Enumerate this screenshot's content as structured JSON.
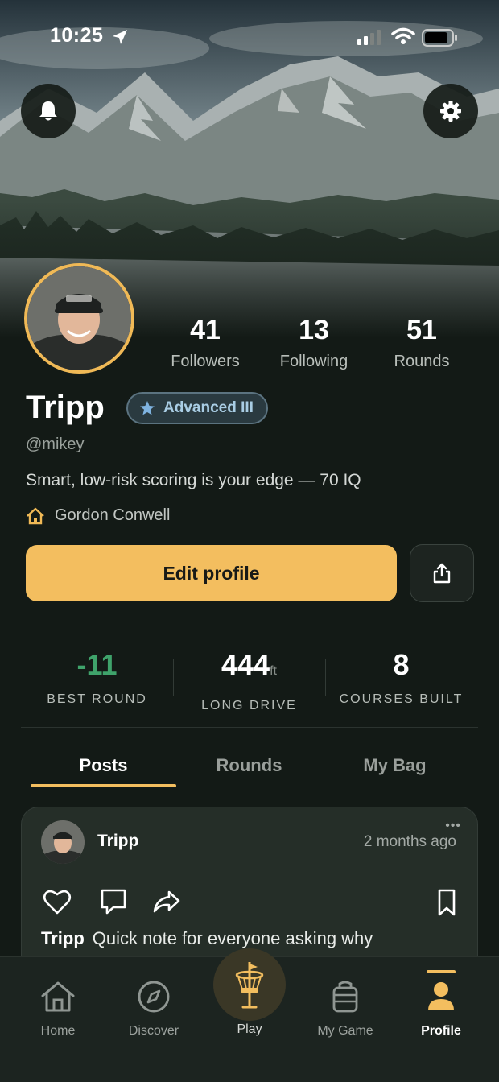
{
  "status_bar": {
    "time": "10:25"
  },
  "profile": {
    "name": "Tripp",
    "badge": "Advanced III",
    "handle": "@mikey",
    "bio": "Smart, low-risk scoring is your edge — 70 IQ",
    "home_course": "Gordon Conwell",
    "stats": [
      {
        "value": "41",
        "label": "Followers"
      },
      {
        "value": "13",
        "label": "Following"
      },
      {
        "value": "51",
        "label": "Rounds"
      }
    ],
    "edit_label": "Edit profile"
  },
  "kpis": [
    {
      "value": "-11",
      "unit": "",
      "label": "BEST ROUND",
      "color": "#3fa36b"
    },
    {
      "value": "444",
      "unit": "ft",
      "label": "LONG DRIVE",
      "color": "#ffffff"
    },
    {
      "value": "8",
      "unit": "",
      "label": "COURSES BUILT",
      "color": "#ffffff"
    }
  ],
  "tabs": [
    {
      "label": "Posts",
      "active": true
    },
    {
      "label": "Rounds",
      "active": false
    },
    {
      "label": "My Bag",
      "active": false
    }
  ],
  "post": {
    "author": "Tripp",
    "time": "2 months ago",
    "more": "•••",
    "text_author": "Tripp",
    "text": "Quick note for everyone asking why"
  },
  "nav": {
    "home": "Home",
    "discover": "Discover",
    "play": "Play",
    "my_game": "My Game",
    "profile": "Profile"
  },
  "colors": {
    "accent": "#f3be5f",
    "badge_text": "#a9cde4",
    "positive": "#3fa36b"
  }
}
